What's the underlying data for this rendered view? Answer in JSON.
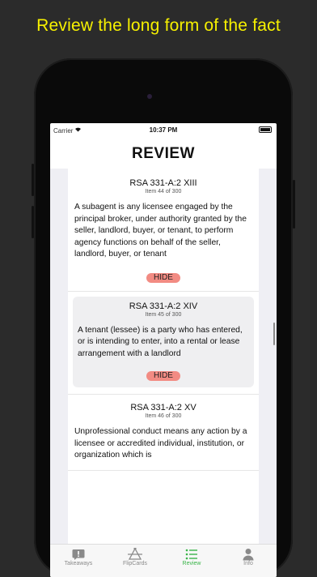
{
  "headline": "Review the long form of the fact",
  "status": {
    "carrier": "Carrier",
    "time": "10:37 PM"
  },
  "nav": {
    "title": "REVIEW"
  },
  "cards": [
    {
      "title": "RSA 331-A:2 XIII",
      "item": "Item 44 of 300",
      "body": "A subagent is any licensee engaged by the principal broker, under authority granted by the seller, landlord, buyer, or tenant, to perform agency functions on behalf of the seller, landlord, buyer, or tenant",
      "hide": "HIDE"
    },
    {
      "title": "RSA 331-A:2 XIV",
      "item": "Item 45 of 300",
      "body": "A tenant (lessee) is a party who has entered, or is intending to enter, into a rental or lease arrangement with a landlord",
      "hide": "HIDE"
    },
    {
      "title": "RSA 331-A:2 XV",
      "item": "Item 46 of 300",
      "body": "Unprofessional conduct means any action by a licensee or accredited individual, institution, or organization which is",
      "hide": "HIDE"
    }
  ],
  "tabs": [
    {
      "label": "Takeaways",
      "icon": "exclamation-bubble-icon"
    },
    {
      "label": "FlipCards",
      "icon": "flipcards-icon"
    },
    {
      "label": "Review",
      "icon": "list-icon"
    },
    {
      "label": "Info",
      "icon": "person-icon"
    }
  ],
  "colors": {
    "headline": "#f7f100",
    "hide": "#f28b83",
    "active_tab": "#3bb54a"
  }
}
